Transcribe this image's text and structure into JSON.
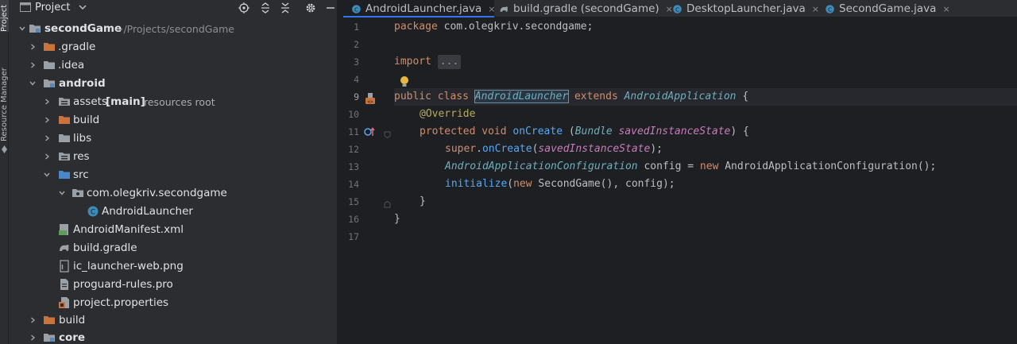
{
  "side_tabs": {
    "project": "Project",
    "resource_manager": "Resource Manager"
  },
  "project_panel": {
    "title": "Project",
    "tree": [
      {
        "label": "secondGame",
        "path": "~/Projects/secondGame",
        "bold": true,
        "icon": "module-folder-icon"
      },
      {
        "label": ".gradle",
        "icon": "folder-orange-icon"
      },
      {
        "label": ".idea",
        "icon": "folder-icon"
      },
      {
        "label": "android",
        "bold": true,
        "icon": "module-folder-icon"
      },
      {
        "label": "assets",
        "extra": "[main]",
        "hint": "resources root",
        "icon": "resources-folder-icon"
      },
      {
        "label": "build",
        "icon": "folder-orange-icon"
      },
      {
        "label": "libs",
        "icon": "folder-icon"
      },
      {
        "label": "res",
        "icon": "res-folder-icon"
      },
      {
        "label": "src",
        "icon": "source-folder-icon"
      },
      {
        "label": "com.olegkriv.secondgame",
        "icon": "package-icon"
      },
      {
        "label": "AndroidLauncher",
        "icon": "class-icon"
      },
      {
        "label": "AndroidManifest.xml",
        "icon": "manifest-icon"
      },
      {
        "label": "build.gradle",
        "icon": "gradle-icon"
      },
      {
        "label": "ic_launcher-web.png",
        "icon": "image-file-icon"
      },
      {
        "label": "proguard-rules.pro",
        "icon": "text-file-icon"
      },
      {
        "label": "project.properties",
        "icon": "properties-file-icon"
      },
      {
        "label": "build",
        "icon": "folder-orange-icon"
      },
      {
        "label": "core",
        "bold": true,
        "icon": "module-folder-icon"
      }
    ]
  },
  "tabs": [
    {
      "label": "AndroidLauncher.java",
      "icon": "class-icon",
      "active": true
    },
    {
      "label": "build.gradle (secondGame)",
      "icon": "gradle-icon"
    },
    {
      "label": "DesktopLauncher.java",
      "icon": "class-icon"
    },
    {
      "label": "SecondGame.java",
      "icon": "class-icon"
    }
  ],
  "tab_close_glyph": "×",
  "editor": {
    "line_numbers": [
      "1",
      "2",
      "3",
      "4",
      "9",
      "10",
      "11",
      "12",
      "13",
      "14",
      "15",
      "16",
      "17"
    ],
    "code": {
      "l1_kw": "package",
      "l1_rest": " com.olegkriv.secondgame;",
      "l3_kw": "import",
      "l3_fold": "...",
      "l9_kw1": "public class",
      "l9_name": "AndroidLauncher",
      "l9_kw2": "extends",
      "l9_super": "AndroidApplication",
      "l9_brace": " {",
      "l10_ann": "@Override",
      "l11_kw": "protected void",
      "l11_meth": "onCreate",
      "l11_open": " (",
      "l11_type": "Bundle",
      "l11_param": "savedInstanceState",
      "l11_close": ") {",
      "l12_kw": "super",
      "l12_dot": ".",
      "l12_meth": "onCreate",
      "l12_open": "(",
      "l12_param": "savedInstanceState",
      "l12_close": ");",
      "l13_type": "AndroidApplicationConfiguration",
      "l13_var": " config = ",
      "l13_kw": "new",
      "l13_ctor": " AndroidApplicationConfiguration();",
      "l14_meth": "initialize",
      "l14_open": "(",
      "l14_kw": "new",
      "l14_rest": " SecondGame(), config);",
      "l15": "}",
      "l16": "}"
    }
  },
  "colors": {
    "accent": "#3574f0",
    "selection": "#2e436e",
    "keyword": "#cf8e6d",
    "annotation": "#b3ae60"
  }
}
